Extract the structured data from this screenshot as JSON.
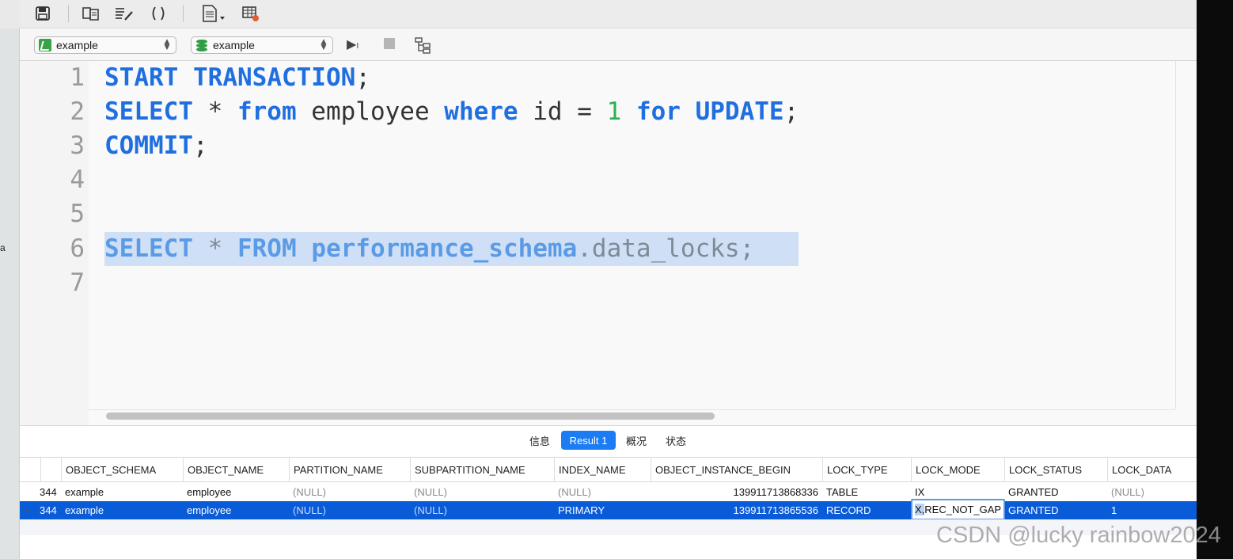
{
  "left_fragment": "a",
  "toolbar": {
    "icons": [
      "save-icon",
      "open-snippet-icon",
      "beautify-icon",
      "brackets-icon",
      "document-menu-icon",
      "table-grid-icon"
    ]
  },
  "connection": {
    "schema_select": "example",
    "database_select": "example"
  },
  "editor": {
    "line_numbers": [
      "1",
      "2",
      "3",
      "4",
      "5",
      "6",
      "7"
    ],
    "line1": {
      "kw1": "START",
      "kw2": "TRANSACTION",
      "tail": ";"
    },
    "line2": {
      "kw1": "SELECT",
      "star": " * ",
      "kw2": "from",
      "tbl": " employee ",
      "kw3": "where",
      "cond": " id = ",
      "num": "1",
      "kw4": "for",
      "kw5": "UPDATE",
      "tail": ";"
    },
    "line3": {
      "kw1": "COMMIT",
      "tail": ";"
    },
    "line6": {
      "kw1": "SELECT",
      "star": " * ",
      "kw2": "FROM",
      "schema": "performance_schema",
      "tail": ".data_locks;"
    }
  },
  "result_tabs": [
    "信息",
    "Result 1",
    "概况",
    "状态"
  ],
  "grid": {
    "columns": [
      "OBJECT_SCHEMA",
      "OBJECT_NAME",
      "PARTITION_NAME",
      "SUBPARTITION_NAME",
      "INDEX_NAME",
      "OBJECT_INSTANCE_BEGIN",
      "LOCK_TYPE",
      "LOCK_MODE",
      "LOCK_STATUS",
      "LOCK_DATA"
    ],
    "rows": [
      {
        "prefix": "344",
        "OBJECT_SCHEMA": "example",
        "OBJECT_NAME": "employee",
        "PARTITION_NAME": "(NULL)",
        "SUBPARTITION_NAME": "(NULL)",
        "INDEX_NAME": "(NULL)",
        "OBJECT_INSTANCE_BEGIN": "139911713868336",
        "LOCK_TYPE": "TABLE",
        "LOCK_MODE": "IX",
        "LOCK_STATUS": "GRANTED",
        "LOCK_DATA": "(NULL)"
      },
      {
        "prefix": "344",
        "OBJECT_SCHEMA": "example",
        "OBJECT_NAME": "employee",
        "PARTITION_NAME": "(NULL)",
        "SUBPARTITION_NAME": "(NULL)",
        "INDEX_NAME": "PRIMARY",
        "OBJECT_INSTANCE_BEGIN": "139911713865536",
        "LOCK_TYPE": "RECORD",
        "LOCK_MODE_sel": "X,",
        "LOCK_MODE_rest": "REC_NOT_GAP",
        "LOCK_STATUS": "GRANTED",
        "LOCK_DATA": "1"
      }
    ]
  },
  "watermark": "CSDN @lucky rainbow2024",
  "colors": {
    "keyword": "#1f6fe0",
    "number": "#2bb24c",
    "selection": "#cfe0f6",
    "selected_row": "#0a5bd8",
    "active_tab": "#1b7cf4"
  }
}
